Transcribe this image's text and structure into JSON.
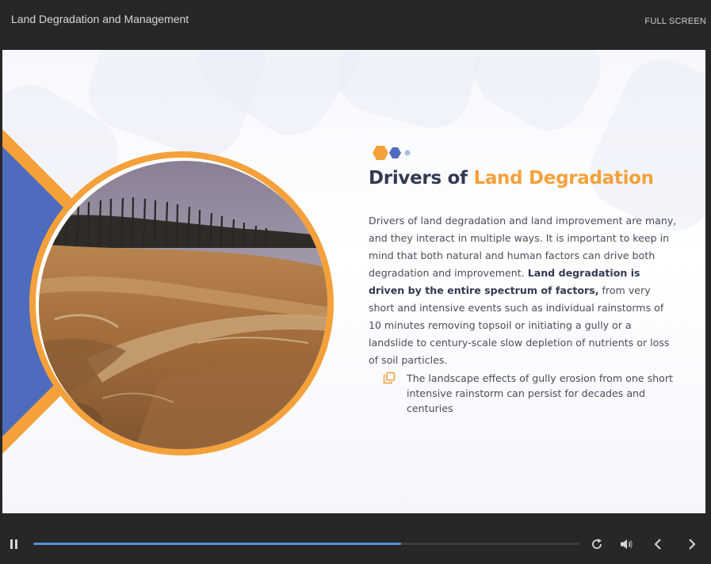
{
  "window": {
    "course_title": "Land Degradation and Management",
    "fullscreen_label": "FULL SCREEN"
  },
  "slide": {
    "heading_part1": "Drivers of ",
    "heading_part2": "Land Degradation",
    "paragraph_intro": "Drivers of land degradation and land improvement are many, and they interact in multiple ways. It is important to keep in mind that both natural and human factors can drive both degradation and improvement. ",
    "paragraph_bold": "Land degradation is driven by the entire spectrum of factors,",
    "paragraph_rest": " from very short and intensive events such as individual rainstorms of 10 minutes removing topsoil or initiating a gully or a landslide to century-scale slow depletion of nutrients or loss of soil particles.",
    "note_text": "The landscape effects of gully erosion from one short intensive rainstorm can persist for decades and centuries",
    "note_icon": "copy-icon",
    "photo": "eroded-quarry-landscape-photo"
  },
  "player": {
    "progress_fraction": 0.673,
    "icons": [
      "pause-icon",
      "replay-icon",
      "volume-icon",
      "previous-icon",
      "next-icon"
    ]
  },
  "colors": {
    "accent_orange": "#f4a13b",
    "accent_blue": "#4e6bbd",
    "heading_dark": "#333a52",
    "progress_blue": "#5b8fd6"
  }
}
